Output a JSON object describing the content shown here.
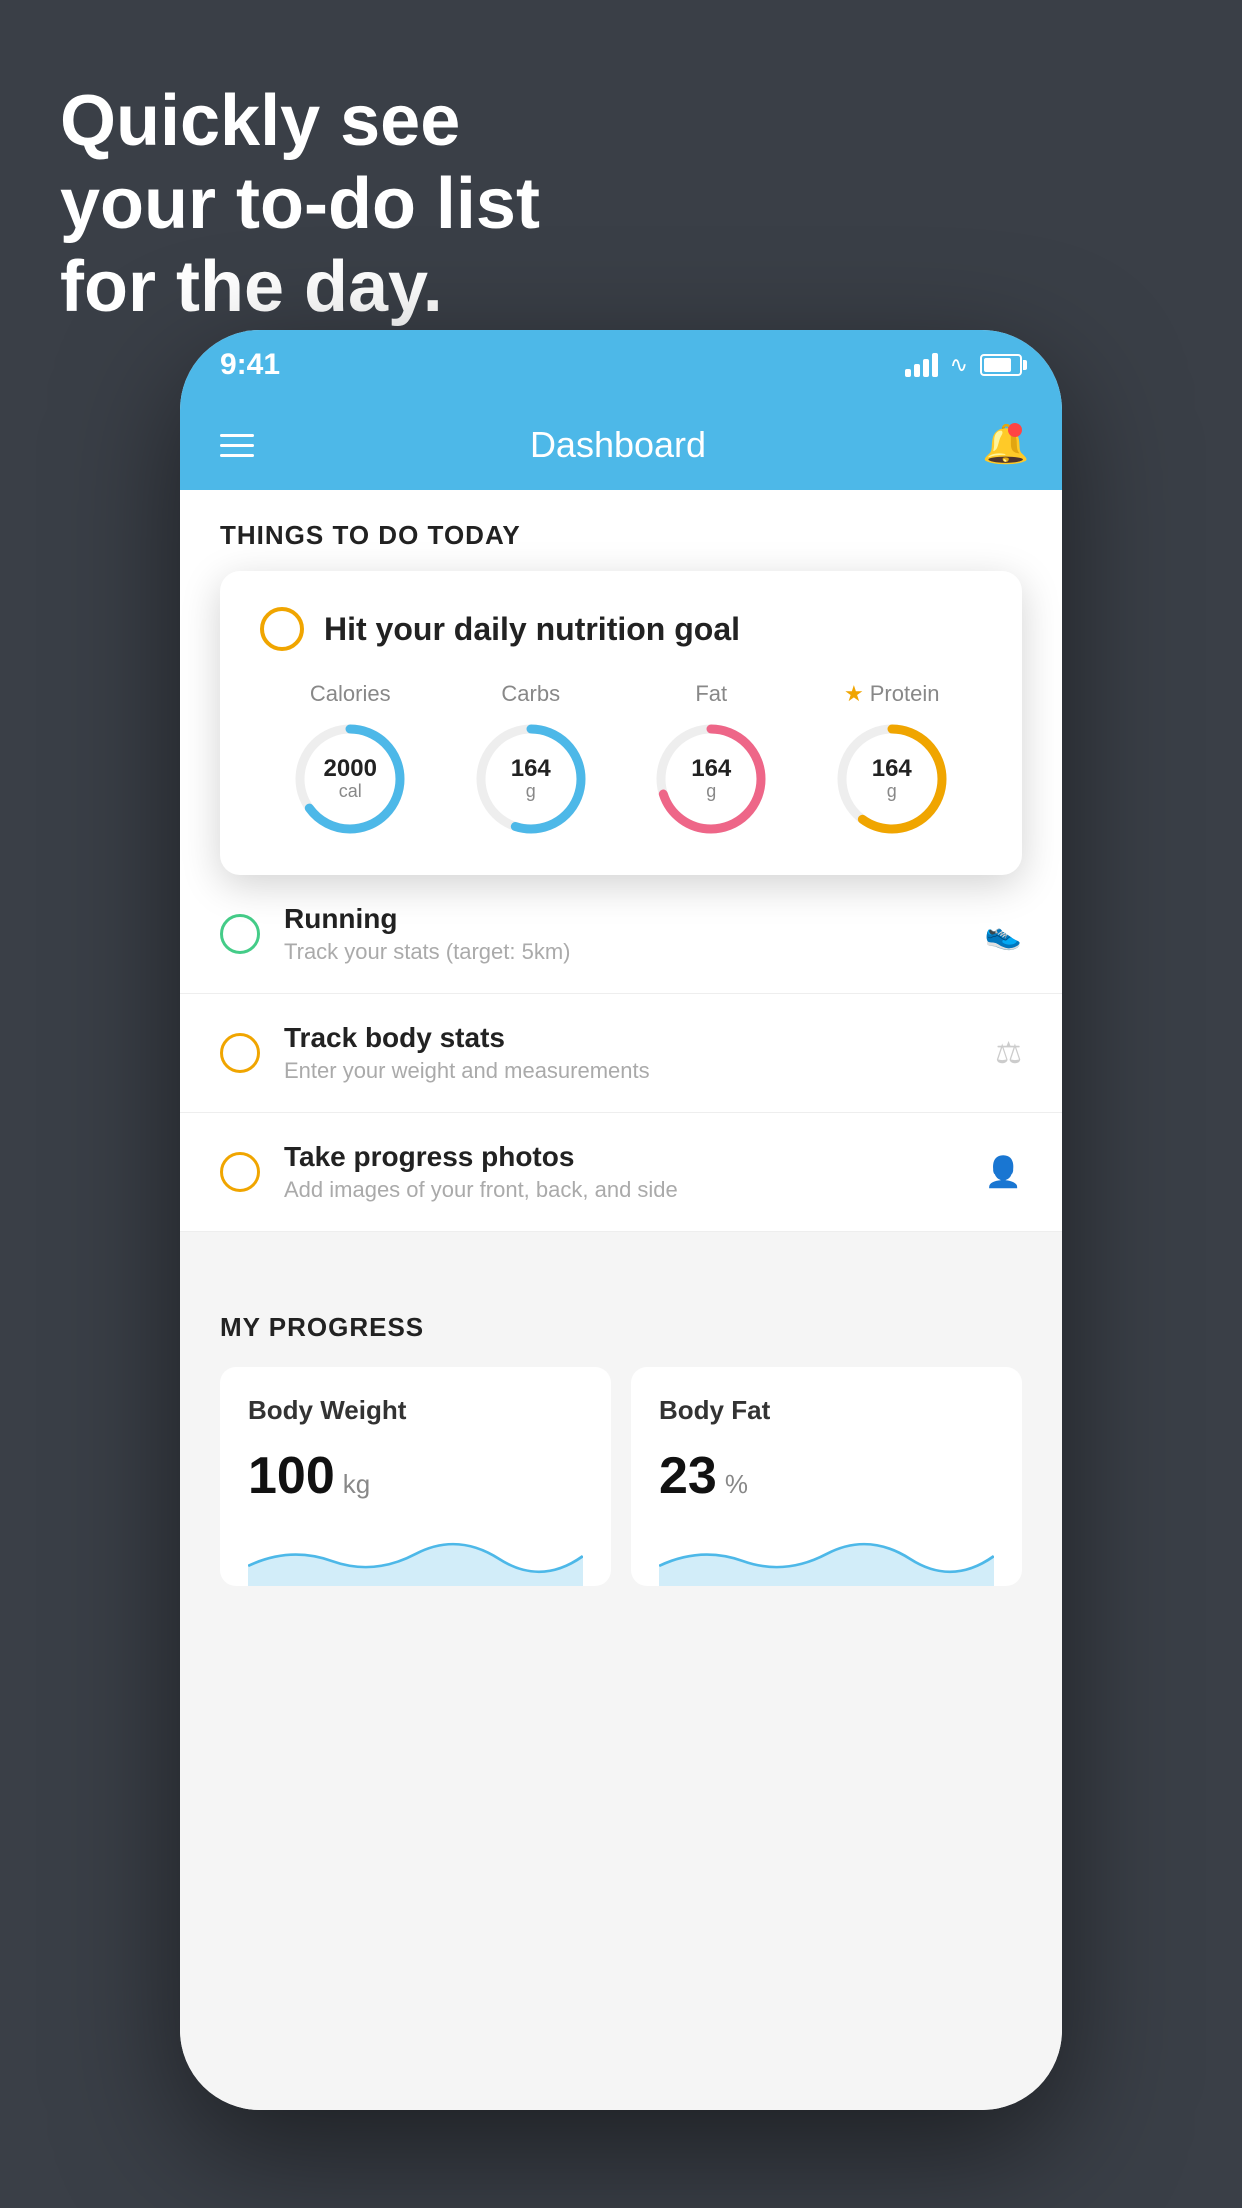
{
  "background": {
    "color": "#3a3f47"
  },
  "hero": {
    "line1": "Quickly see",
    "line2": "your to-do list",
    "line3": "for the day."
  },
  "status_bar": {
    "time": "9:41",
    "bg_color": "#4db8e8"
  },
  "header": {
    "title": "Dashboard",
    "bg_color": "#4db8e8"
  },
  "things_section": {
    "title": "THINGS TO DO TODAY"
  },
  "nutrition_card": {
    "title": "Hit your daily nutrition goal",
    "items": [
      {
        "label": "Calories",
        "value": "2000",
        "unit": "cal",
        "color": "#4db8e8",
        "progress": 0.65,
        "has_star": false
      },
      {
        "label": "Carbs",
        "value": "164",
        "unit": "g",
        "color": "#4db8e8",
        "progress": 0.55,
        "has_star": false
      },
      {
        "label": "Fat",
        "value": "164",
        "unit": "g",
        "color": "#ee6688",
        "progress": 0.7,
        "has_star": false
      },
      {
        "label": "Protein",
        "value": "164",
        "unit": "g",
        "color": "#f0a500",
        "progress": 0.6,
        "has_star": true
      }
    ]
  },
  "todo_items": [
    {
      "title": "Running",
      "subtitle": "Track your stats (target: 5km)",
      "circle_color": "green",
      "icon": "👟"
    },
    {
      "title": "Track body stats",
      "subtitle": "Enter your weight and measurements",
      "circle_color": "yellow",
      "icon": "⚖"
    },
    {
      "title": "Take progress photos",
      "subtitle": "Add images of your front, back, and side",
      "circle_color": "yellow",
      "icon": "👤"
    }
  ],
  "progress_section": {
    "title": "MY PROGRESS",
    "cards": [
      {
        "title": "Body Weight",
        "value": "100",
        "unit": "kg",
        "chart_color": "#4db8e8"
      },
      {
        "title": "Body Fat",
        "value": "23",
        "unit": "%",
        "chart_color": "#4db8e8"
      }
    ]
  }
}
